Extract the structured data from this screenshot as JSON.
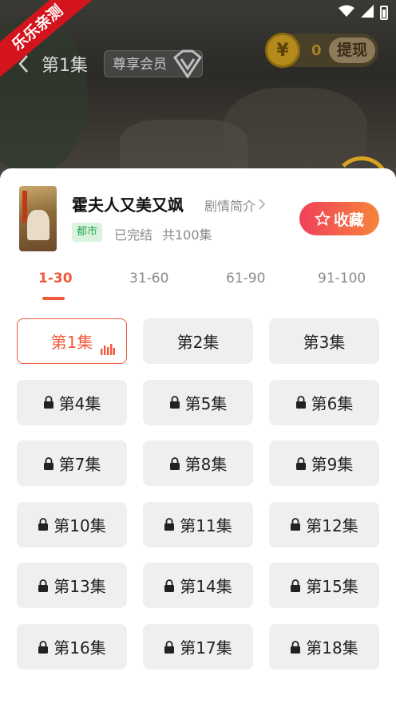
{
  "brand_ribbon": "乐乐亲测",
  "player": {
    "episode_title": "第1集",
    "vip_label": "尊享会员",
    "coin_symbol": "¥",
    "coin_count": "0",
    "withdraw_label": "提现"
  },
  "drama": {
    "title": "霍夫人又美又飒",
    "synopsis_label": "剧情简介",
    "genre_tag": "都市",
    "status": "已完结",
    "episode_count": "共100集",
    "favorite_label": "收藏"
  },
  "range_tabs": [
    "1-30",
    "31-60",
    "61-90",
    "91-100"
  ],
  "active_range_index": 0,
  "episodes": [
    {
      "label": "第1集",
      "locked": false,
      "current": true
    },
    {
      "label": "第2集",
      "locked": false,
      "current": false
    },
    {
      "label": "第3集",
      "locked": false,
      "current": false
    },
    {
      "label": "第4集",
      "locked": true,
      "current": false
    },
    {
      "label": "第5集",
      "locked": true,
      "current": false
    },
    {
      "label": "第6集",
      "locked": true,
      "current": false
    },
    {
      "label": "第7集",
      "locked": true,
      "current": false
    },
    {
      "label": "第8集",
      "locked": true,
      "current": false
    },
    {
      "label": "第9集",
      "locked": true,
      "current": false
    },
    {
      "label": "第10集",
      "locked": true,
      "current": false
    },
    {
      "label": "第11集",
      "locked": true,
      "current": false
    },
    {
      "label": "第12集",
      "locked": true,
      "current": false
    },
    {
      "label": "第13集",
      "locked": true,
      "current": false
    },
    {
      "label": "第14集",
      "locked": true,
      "current": false
    },
    {
      "label": "第15集",
      "locked": true,
      "current": false
    },
    {
      "label": "第16集",
      "locked": true,
      "current": false
    },
    {
      "label": "第17集",
      "locked": true,
      "current": false
    },
    {
      "label": "第18集",
      "locked": true,
      "current": false
    }
  ],
  "colors": {
    "accent": "#f15a3a",
    "favorite_gradient_start": "#f0405a",
    "favorite_gradient_end": "#f7843a",
    "genre_tag_bg": "#d8f3de",
    "genre_tag_text": "#2fa85a",
    "ribbon": "#d4141c"
  },
  "icons": [
    "wifi-icon",
    "signal-icon",
    "battery-icon",
    "back-icon",
    "vip-gem-icon",
    "coin-icon",
    "chevron-right-icon",
    "star-icon",
    "lock-icon",
    "playing-icon"
  ]
}
